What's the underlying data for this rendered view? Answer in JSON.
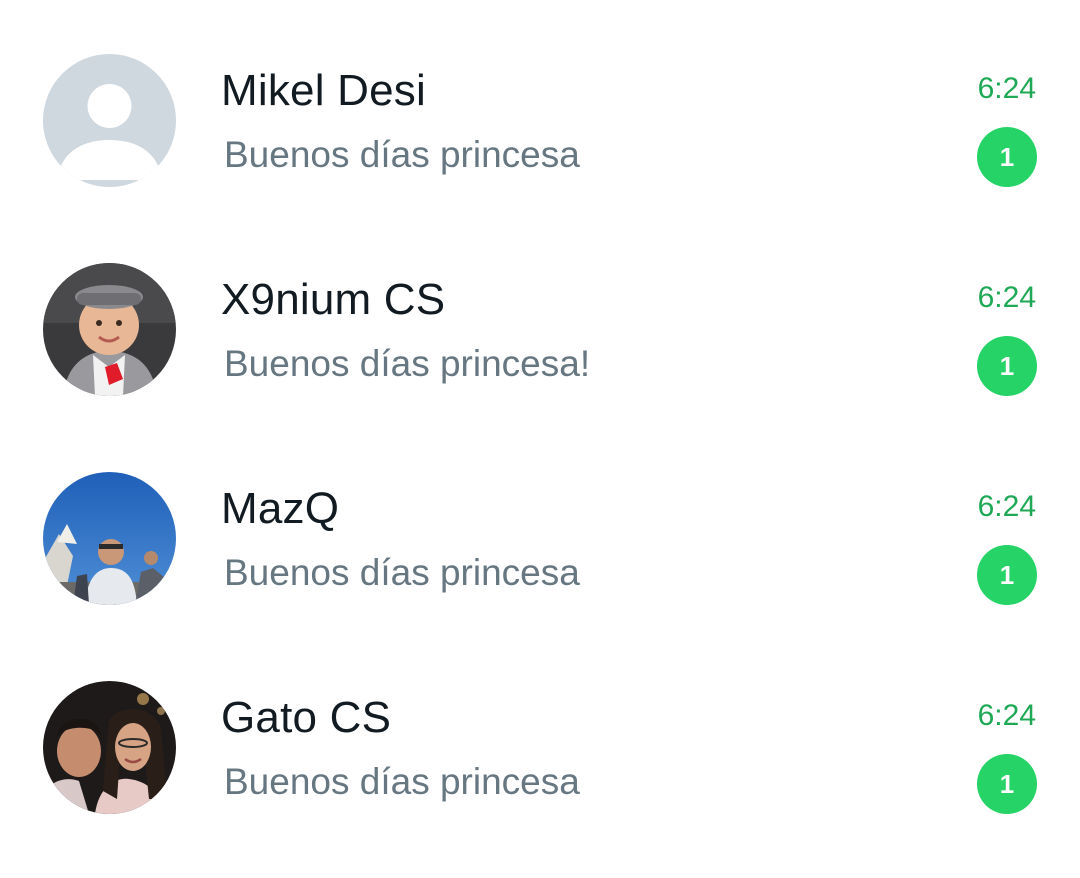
{
  "theme": {
    "name_color": "#111b21",
    "preview_color": "#667781",
    "time_color": "#1fa855",
    "badge_color": "#25d366"
  },
  "chats": [
    {
      "name": "Mikel Desi",
      "preview": "Buenos días princesa",
      "time": "6:24",
      "unread": "1",
      "avatar": "default-person-icon"
    },
    {
      "name": "X9nium CS",
      "preview": "Buenos días princesa!",
      "time": "6:24",
      "unread": "1",
      "avatar": "baby-photo"
    },
    {
      "name": "MazQ",
      "preview": "Buenos días princesa",
      "time": "6:24",
      "unread": "1",
      "avatar": "outdoor-person-photo"
    },
    {
      "name": "Gato CS",
      "preview": "Buenos días princesa",
      "time": "6:24",
      "unread": "1",
      "avatar": "couple-photo"
    }
  ]
}
